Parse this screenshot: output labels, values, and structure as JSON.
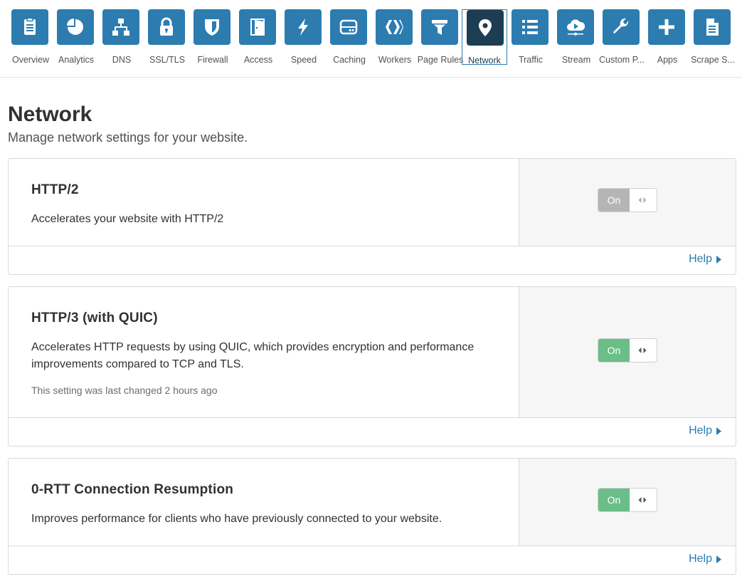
{
  "nav": {
    "items": [
      {
        "label": "Overview",
        "icon": "document-icon",
        "active": false
      },
      {
        "label": "Analytics",
        "icon": "pie-chart-icon",
        "active": false
      },
      {
        "label": "DNS",
        "icon": "network-tree-icon",
        "active": false
      },
      {
        "label": "SSL/TLS",
        "icon": "lock-icon",
        "active": false
      },
      {
        "label": "Firewall",
        "icon": "shield-icon",
        "active": false
      },
      {
        "label": "Access",
        "icon": "door-icon",
        "active": false
      },
      {
        "label": "Speed",
        "icon": "lightning-icon",
        "active": false
      },
      {
        "label": "Caching",
        "icon": "server-icon",
        "active": false
      },
      {
        "label": "Workers",
        "icon": "workers-icon",
        "active": false
      },
      {
        "label": "Page Rules",
        "icon": "filter-icon",
        "active": false
      },
      {
        "label": "Network",
        "icon": "location-pin-icon",
        "active": true
      },
      {
        "label": "Traffic",
        "icon": "list-icon",
        "active": false
      },
      {
        "label": "Stream",
        "icon": "cloud-play-icon",
        "active": false
      },
      {
        "label": "Custom P...",
        "icon": "wrench-icon",
        "active": false
      },
      {
        "label": "Apps",
        "icon": "plus-icon",
        "active": false
      },
      {
        "label": "Scrape S...",
        "icon": "file-icon",
        "active": false
      }
    ]
  },
  "page": {
    "title": "Network",
    "subtitle": "Manage network settings for your website."
  },
  "settings": [
    {
      "title": "HTTP/2",
      "description": "Accelerates your website with HTTP/2",
      "meta": "",
      "toggle_label": "On",
      "state": "on-disabled",
      "help_label": "Help"
    },
    {
      "title": "HTTP/3 (with QUIC)",
      "description": "Accelerates HTTP requests by using QUIC, which provides encryption and performance improvements compared to TCP and TLS.",
      "meta": "This setting was last changed 2 hours ago",
      "toggle_label": "On",
      "state": "on",
      "help_label": "Help"
    },
    {
      "title": "0-RTT Connection Resumption",
      "description": "Improves performance for clients who have previously connected to your website.",
      "meta": "",
      "toggle_label": "On",
      "state": "on",
      "help_label": "Help"
    }
  ],
  "colors": {
    "accent": "#2c7cb0",
    "active_tile": "#1d3d52",
    "toggle_on": "#6bbe88",
    "toggle_disabled": "#b5b5b5",
    "control_panel_bg": "#f6f6f6"
  }
}
